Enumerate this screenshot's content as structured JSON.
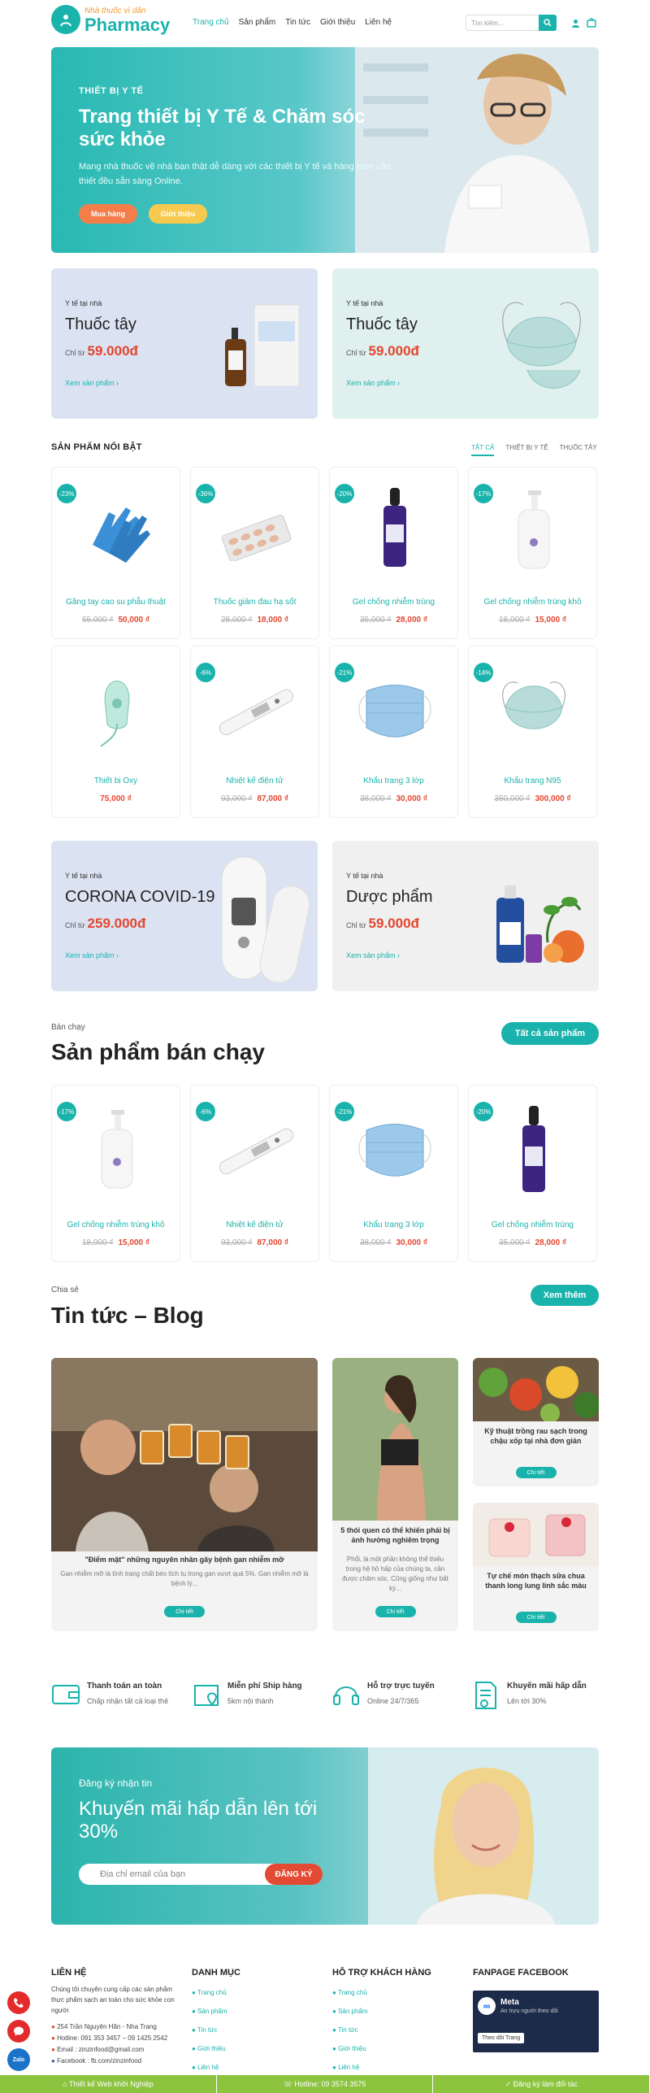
{
  "header": {
    "logo_small": "Nhà thuốc vì dân",
    "logo_big": "Pharmacy",
    "nav": [
      "Trang chủ",
      "Sản phẩm",
      "Tin tức",
      "Giới thiệu",
      "Liên hệ"
    ],
    "search_placeholder": "Tìm kiếm..."
  },
  "hero": {
    "kicker": "THIẾT BỊ Y TẾ",
    "title": "Trang thiết bị Y Tế & Chăm sóc sức khỏe",
    "text": "Mang nhà thuốc về nhà bạn thật dễ dàng với các thiết bị Y tế và hàng men cần thiết đều sẵn sàng Online.",
    "btn_buy": "Mua hàng",
    "btn_intro": "Giới thiệu"
  },
  "promos": [
    {
      "small": "Y tế tại nhà",
      "title": "Thuốc tây",
      "from": "Chỉ từ",
      "price": "59.000đ",
      "link": "Xem sản phẩm ›"
    },
    {
      "small": "Y tế tại nhà",
      "title": "Thuốc tây",
      "from": "Chỉ từ",
      "price": "59.000đ",
      "link": "Xem sản phẩm ›"
    },
    {
      "small": "Y tế tại nhà",
      "title": "CORONA COVID-19",
      "from": "Chỉ từ",
      "price": "259.000đ",
      "link": "Xem sản phẩm ›"
    },
    {
      "small": "Y tế tại nhà",
      "title": "Dược phẩm",
      "from": "Chỉ từ",
      "price": "59.000đ",
      "link": "Xem sản phẩm ›"
    }
  ],
  "featured": {
    "title": "SẢN PHẨM NỔI BẬT",
    "tabs": [
      "TẤT CẢ",
      "THIẾT BỊ Y TẾ",
      "THUỐC TÂY"
    ],
    "products": [
      {
        "discount": "-23%",
        "name": "Găng tay cao su phẫu thuật",
        "old": "65.000 ₫",
        "price": "50,000 ₫"
      },
      {
        "discount": "-36%",
        "name": "Thuốc giảm đau hạ sốt",
        "old": "28,000 ₫",
        "price": "18,000 ₫"
      },
      {
        "discount": "-20%",
        "name": "Gel chống nhiễm trùng",
        "old": "35,000 ₫",
        "price": "28,000 ₫"
      },
      {
        "discount": "-17%",
        "name": "Gel chống nhiễm trùng khô",
        "old": "18,000 ₫",
        "price": "15,000 ₫"
      },
      {
        "discount": "",
        "name": "Thiết bị Oxy",
        "old": "",
        "price": "75,000 ₫"
      },
      {
        "discount": "-6%",
        "name": "Nhiệt kế điện tử",
        "old": "93,000 ₫",
        "price": "87,000 ₫"
      },
      {
        "discount": "-21%",
        "name": "Khẩu trang 3 lớp",
        "old": "38,000 ₫",
        "price": "30,000 ₫"
      },
      {
        "discount": "-14%",
        "name": "Khẩu trang N95",
        "old": "350,000 ₫",
        "price": "300,000 ₫"
      }
    ]
  },
  "bestseller": {
    "kicker": "Bán chạy",
    "title": "Sản phẩm bán chạy",
    "button": "Tất cả sản phẩm",
    "products": [
      {
        "discount": "-17%",
        "name": "Gel chống nhiễm trùng khô",
        "old": "18,000 ₫",
        "price": "15,000 ₫"
      },
      {
        "discount": "-6%",
        "name": "Nhiệt kế điện tử",
        "old": "93,000 ₫",
        "price": "87,000 ₫"
      },
      {
        "discount": "-21%",
        "name": "Khẩu trang 3 lớp",
        "old": "38,000 ₫",
        "price": "30,000 ₫"
      },
      {
        "discount": "-20%",
        "name": "Gel chống nhiễm trùng",
        "old": "35,000 ₫",
        "price": "28,000 ₫"
      }
    ]
  },
  "blog": {
    "kicker": "Chia sẻ",
    "title": "Tin tức – Blog",
    "button": "Xem thêm",
    "posts": [
      {
        "title": "\"Điểm mặt\" những nguyên nhân gây bệnh gan nhiễm mỡ",
        "summary": "Gan nhiễm mỡ là tình trạng chất béo tích tụ trong gan vượt quá 5%. Gan nhiễm mỡ là bệnh lý...",
        "btn": "Chi tiết"
      },
      {
        "title": "5 thói quen có thể khiến phái bị ảnh hưởng nghiêm trọng",
        "summary": "Phổi, là một phần không thể thiếu trong hệ hô hấp của chúng ta, cần được chăm sóc. Cũng giống như bất kỳ...",
        "btn": "Chi tiết"
      },
      {
        "title": "Kỹ thuật trồng rau sạch trong chậu xốp tại nhà đơn giản",
        "summary": "",
        "btn": "Chi tiết"
      },
      {
        "title": "Tự chế món thạch sữa chua thanh long lung linh sắc màu",
        "summary": "",
        "btn": "Chi tiết"
      }
    ]
  },
  "features": [
    {
      "title": "Thanh toán an toàn",
      "sub": "Chấp nhận tất cả loại thẻ"
    },
    {
      "title": "Miễn phí Ship hàng",
      "sub": "5km nội thành"
    },
    {
      "title": "Hỗ trợ trực tuyến",
      "sub": "Online 24/7/365"
    },
    {
      "title": "Khuyến mãi hấp dẫn",
      "sub": "Lên tới 30%"
    }
  ],
  "newsletter": {
    "kicker": "Đăng ký nhận tin",
    "title": "Khuyến mãi hấp dẫn lên tới 30%",
    "placeholder": "Địa chỉ email của bạn",
    "button": "ĐĂNG KÝ"
  },
  "footer": {
    "contact_title": "LIÊN HỆ",
    "contact_text": "Chúng tôi chuyên cung cấp các sản phẩm thực phẩm sạch an toàn cho sức khỏe con người",
    "address": "254 Trần Nguyên Hãn - Nha Trang",
    "hotline": "Hotline: 091 353 3457 – 09 1425 2542",
    "email": "Email : zinzinfood@gmail.com",
    "facebook": "Facebook : fb.com/zinzinfood",
    "menu_title": "DANH MỤC",
    "menu": [
      "Trang chủ",
      "Sản phẩm",
      "Tin tức",
      "Giới thiệu",
      "Liên hệ"
    ],
    "support_title": "HỖ TRỢ KHÁCH HÀNG",
    "support": [
      "Trang chủ",
      "Sản phẩm",
      "Tin tức",
      "Giới thiệu",
      "Liên hệ"
    ],
    "fanpage_title": "FANPAGE FACEBOOK",
    "fb_name": "Meta",
    "fb_sub": "An trựu người theo dõi",
    "fb_follow": "Theo dõi Trang"
  },
  "bottombar": {
    "design": "Thiết kế Web khởi Nghiệp",
    "hotline": "Hotline: 09 3574 3575",
    "register": "Đăng ký làm đối tác"
  },
  "side": {
    "zalo": "Zalo"
  }
}
